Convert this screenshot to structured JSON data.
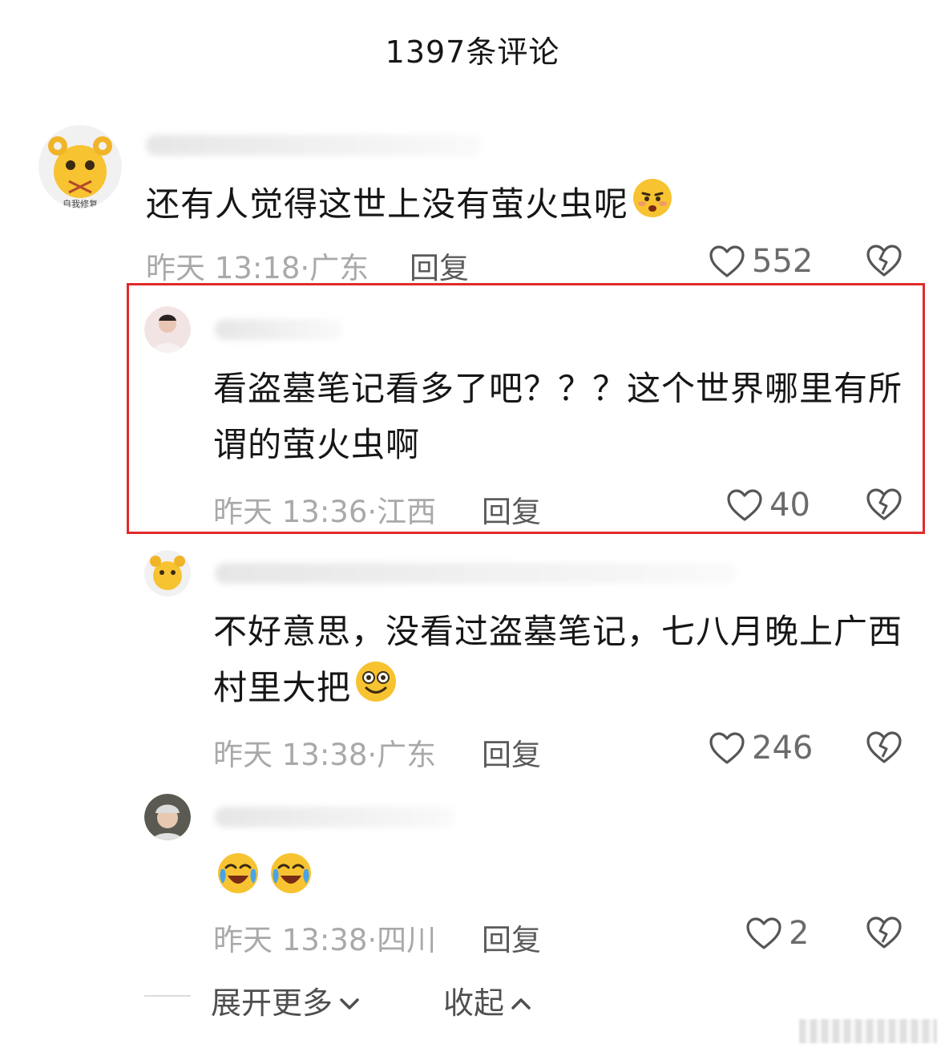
{
  "header": {
    "title": "1397条评论"
  },
  "comments": [
    {
      "text": "还有人觉得这世上没有萤火虫呢",
      "emoji": "weary-face-emoji",
      "time": "昨天 13:18",
      "location": "广东",
      "reply_label": "回复",
      "likes": "552"
    },
    {
      "text": "看盗墓笔记看多了吧？？？这个世界哪里有所谓的萤火虫啊",
      "time": "昨天 13:36",
      "location": "江西",
      "reply_label": "回复",
      "likes": "40"
    },
    {
      "text": "不好意思，没看过盗墓笔记，七八月晚上广西村里大把",
      "emoji": "smiling-face-emoji",
      "time": "昨天 13:38",
      "location": "广东",
      "reply_label": "回复",
      "likes": "246"
    },
    {
      "text": "",
      "emoji": "crying-laughing-emoji",
      "time": "昨天 13:38",
      "location": "四川",
      "reply_label": "回复",
      "likes": "2"
    }
  ],
  "avatar_labels": {
    "self_repair": "自我修复"
  },
  "footer": {
    "expand_label": "展开更多",
    "collapse_label": "收起"
  },
  "colors": {
    "highlight": "#e12a2a",
    "meta_text": "#a9a9a9",
    "emoji_yellow": "#f7c331"
  }
}
